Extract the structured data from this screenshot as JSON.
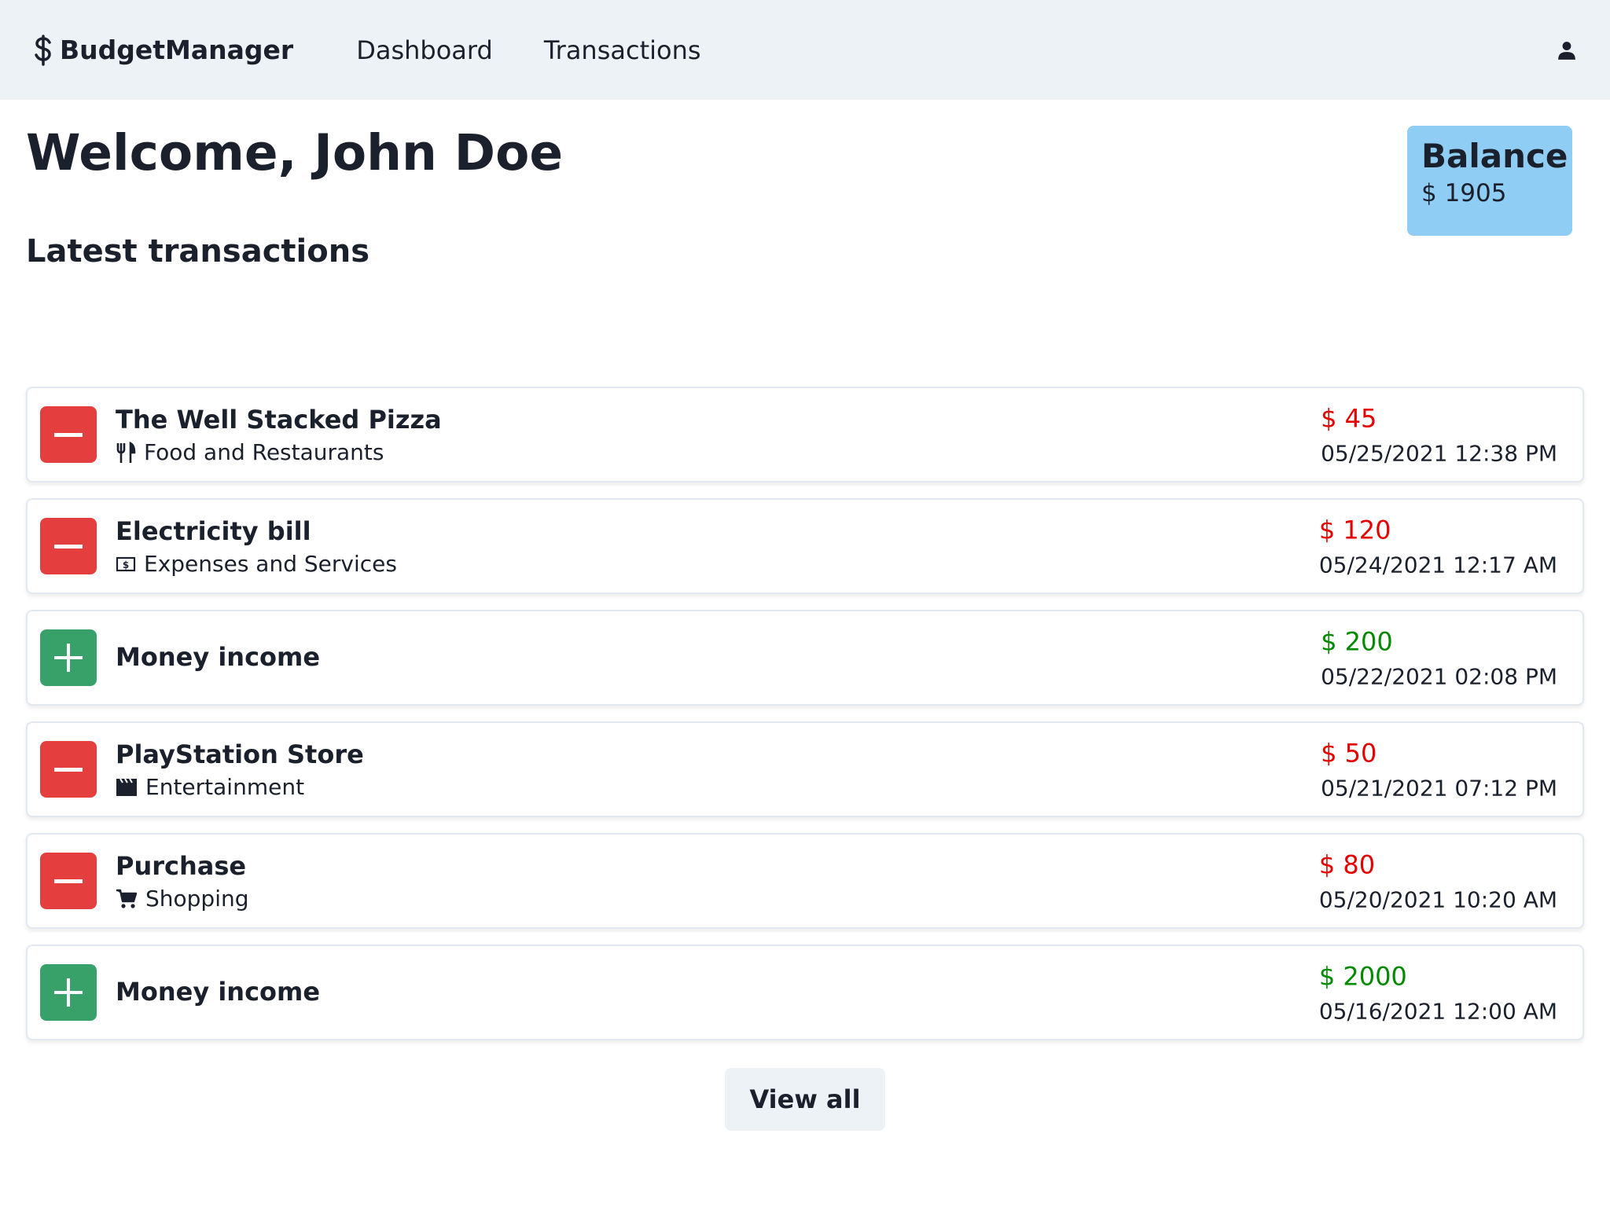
{
  "navbar": {
    "brand": "BudgetManager",
    "links": [
      "Dashboard",
      "Transactions"
    ]
  },
  "welcome": "Welcome, John Doe",
  "balance": {
    "title": "Balance",
    "value": "$ 1905"
  },
  "section_title": "Latest transactions",
  "transactions": [
    {
      "name": "The Well Stacked Pizza",
      "category": "Food and Restaurants",
      "category_icon": "utensils-icon",
      "type": "expense",
      "amount": "$ 45",
      "date": "05/25/2021 12:38 PM"
    },
    {
      "name": "Electricity bill",
      "category": "Expenses and Services",
      "category_icon": "money-bill-icon",
      "type": "expense",
      "amount": "$ 120",
      "date": "05/24/2021 12:17 AM"
    },
    {
      "name": "Money income",
      "category": "",
      "category_icon": "",
      "type": "income",
      "amount": "$ 200",
      "date": "05/22/2021 02:08 PM"
    },
    {
      "name": "PlayStation Store",
      "category": "Entertainment",
      "category_icon": "clapperboard-icon",
      "type": "expense",
      "amount": "$ 50",
      "date": "05/21/2021 07:12 PM"
    },
    {
      "name": "Purchase",
      "category": "Shopping",
      "category_icon": "cart-icon",
      "type": "expense",
      "amount": "$ 80",
      "date": "05/20/2021 10:20 AM"
    },
    {
      "name": "Money income",
      "category": "",
      "category_icon": "",
      "type": "income",
      "amount": "$ 2000",
      "date": "05/16/2021 12:00 AM"
    }
  ],
  "view_all_label": "View all",
  "colors": {
    "expense": "#e53e3e",
    "income": "#38a169",
    "balance_bg": "#90cdf4",
    "nav_bg": "#edf2f7"
  }
}
